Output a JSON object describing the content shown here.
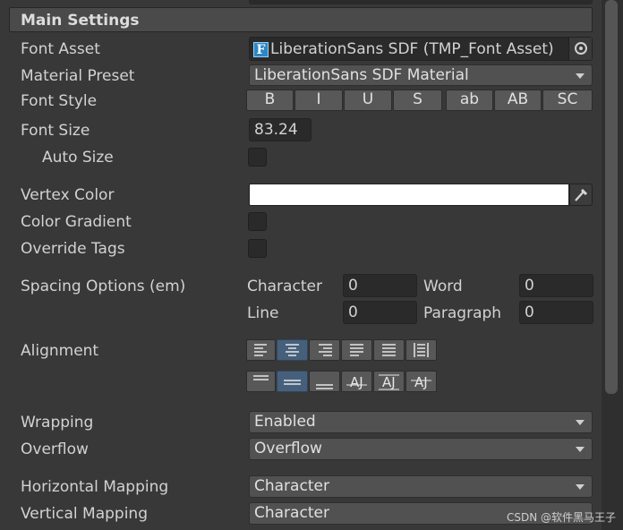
{
  "section_title": "Main Settings",
  "font_asset": {
    "label": "Font Asset",
    "value": "LiberationSans SDF (TMP_Font Asset)",
    "icon": "font-asset-icon"
  },
  "material_preset": {
    "label": "Material Preset",
    "value": "LiberationSans SDF Material"
  },
  "font_style": {
    "label": "Font Style",
    "buttons": [
      "B",
      "I",
      "U",
      "S",
      "ab",
      "AB",
      "SC"
    ]
  },
  "font_size": {
    "label": "Font Size",
    "value": "83.24"
  },
  "auto_size": {
    "label": "Auto Size"
  },
  "vertex_color": {
    "label": "Vertex Color",
    "value": "#ffffff"
  },
  "color_gradient": {
    "label": "Color Gradient"
  },
  "override_tags": {
    "label": "Override Tags"
  },
  "spacing": {
    "label": "Spacing Options (em)",
    "character_label": "Character",
    "character_value": "0",
    "word_label": "Word",
    "word_value": "0",
    "line_label": "Line",
    "line_value": "0",
    "paragraph_label": "Paragraph",
    "paragraph_value": "0"
  },
  "alignment": {
    "label": "Alignment"
  },
  "wrapping": {
    "label": "Wrapping",
    "value": "Enabled"
  },
  "overflow": {
    "label": "Overflow",
    "value": "Overflow"
  },
  "horizontal_mapping": {
    "label": "Horizontal Mapping",
    "value": "Character"
  },
  "vertical_mapping": {
    "label": "Vertical Mapping",
    "value": "Character"
  },
  "watermark": "CSDN @软件黑马王子"
}
